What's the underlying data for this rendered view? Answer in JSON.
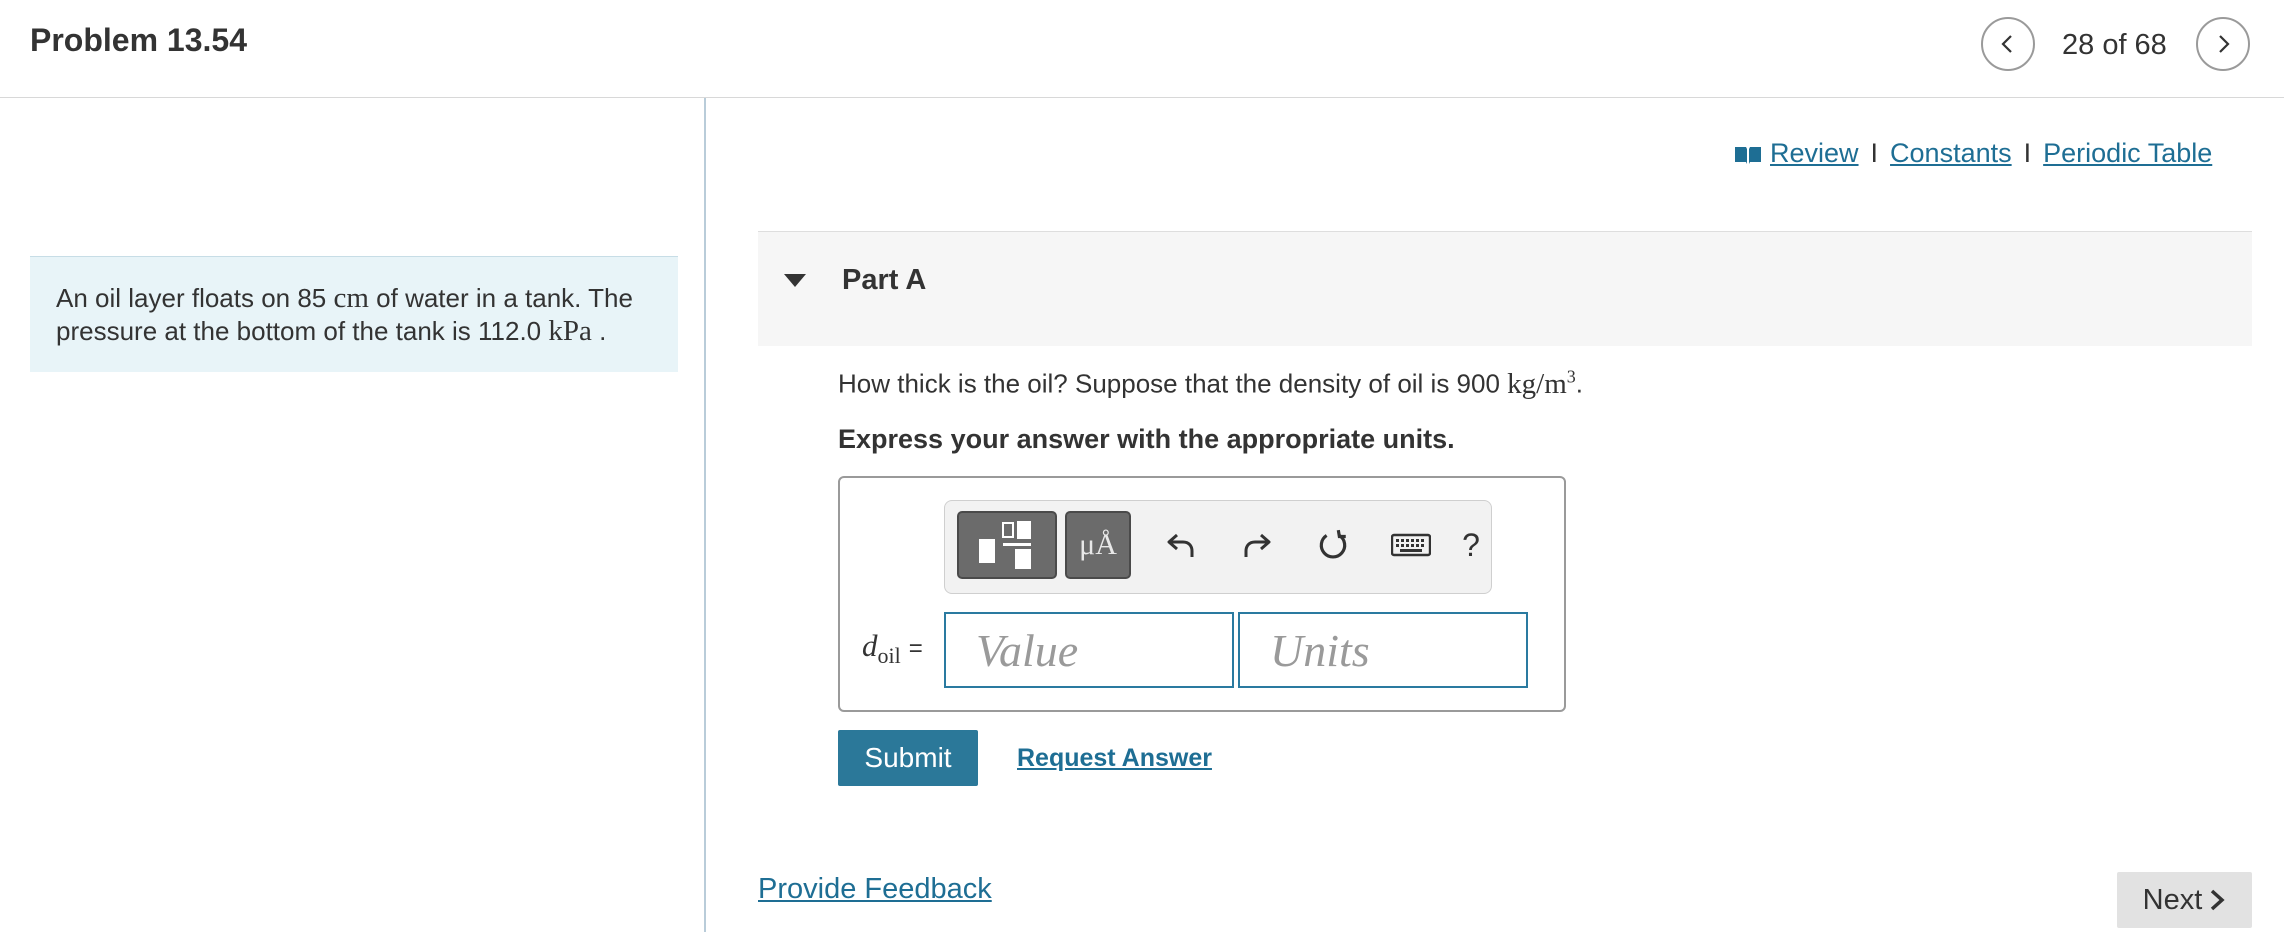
{
  "header": {
    "title": "Problem 13.54",
    "page_count": "28 of 68",
    "prev_icon": "chevron-left-icon",
    "next_icon": "chevron-right-icon"
  },
  "problem": {
    "text_part1": "An oil layer floats on 85 ",
    "unit1": "cm",
    "text_part2": " of water in a tank. The pressure at the bottom of the tank is 112.0 ",
    "unit2": "kPa",
    "text_part3": " ."
  },
  "links": {
    "review": "Review",
    "constants": "Constants",
    "periodic_table": "Periodic Table",
    "separator": "I",
    "review_icon": "book-icon"
  },
  "part": {
    "title": "Part A",
    "question_text": "How thick is the oil? Suppose that the density of oil is 900 ",
    "density_unit": "kg/m",
    "density_exp": "3",
    "question_end": ".",
    "instruction": "Express your answer with the appropriate units."
  },
  "answer": {
    "variable": "d",
    "variable_sub": "oil",
    "equals": "=",
    "value_placeholder": "Value",
    "units_placeholder": "Units",
    "units_button": "μÅ",
    "help": "?"
  },
  "actions": {
    "submit": "Submit",
    "request_answer": "Request Answer",
    "provide_feedback": "Provide Feedback",
    "next": "Next"
  },
  "colors": {
    "accent": "#2b7899",
    "link": "#1e6e94",
    "problem_bg": "#e8f4f8"
  }
}
